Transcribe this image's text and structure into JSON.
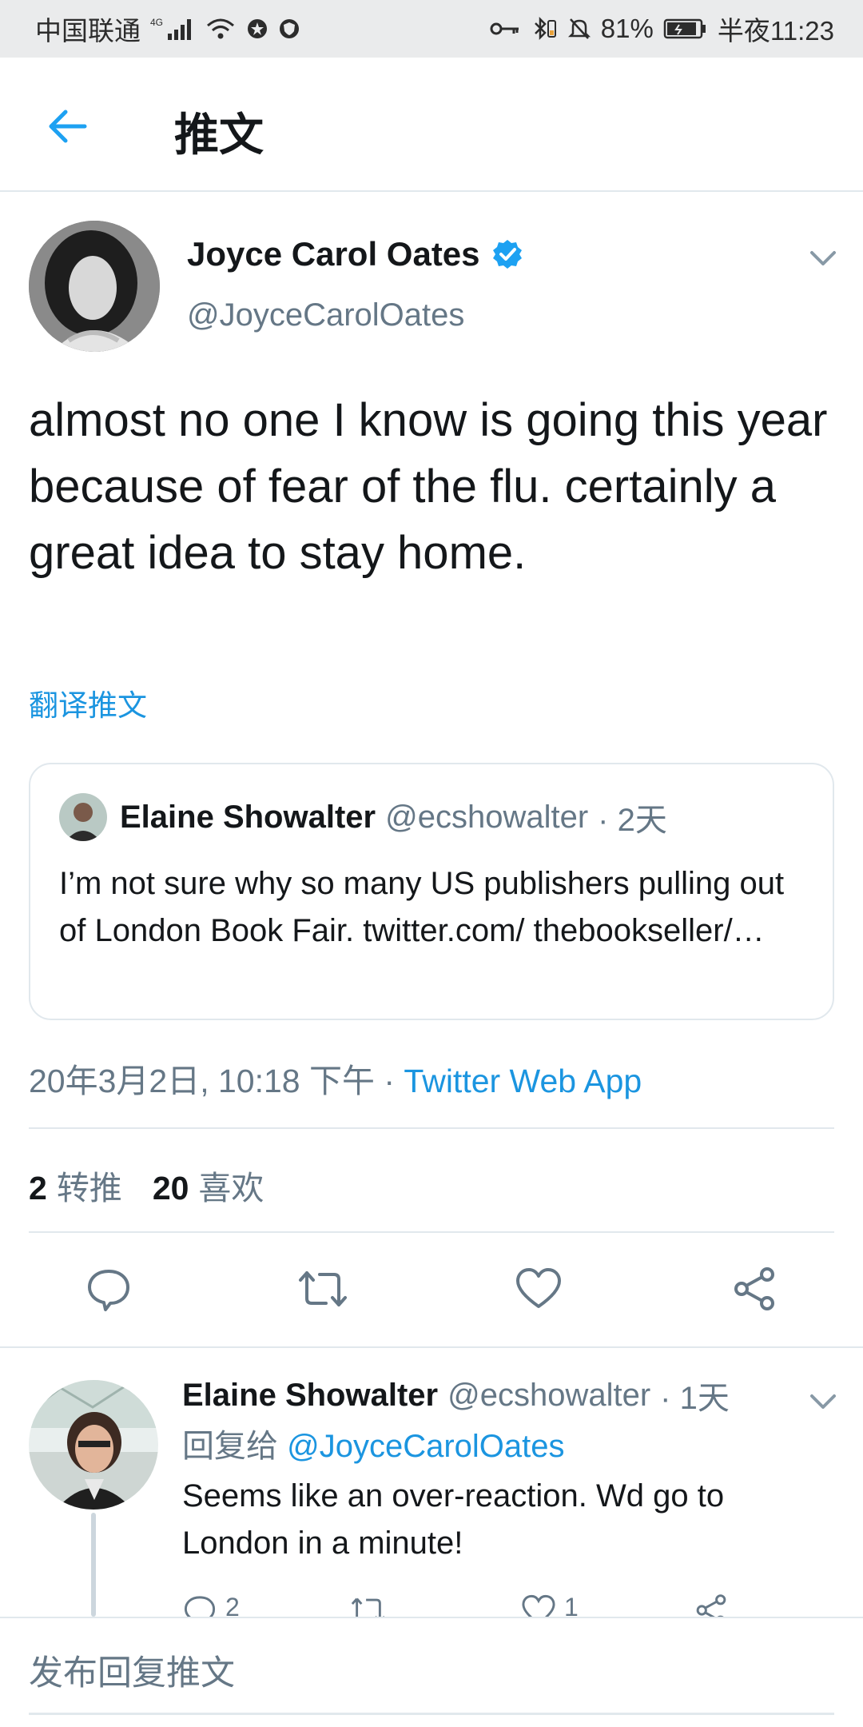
{
  "status_bar": {
    "carrier": "中国联通",
    "network": "4G",
    "battery": "81%",
    "time": "半夜11:23"
  },
  "app_bar": {
    "title": "推文"
  },
  "tweet": {
    "author_name": "Joyce Carol Oates",
    "author_handle": "@JoyceCarolOates",
    "text": "almost no one I know is going this year because of fear of the flu. certainly a great idea to stay home.",
    "translate_label": "翻译推文",
    "quote": {
      "name": "Elaine Showalter",
      "handle": "@ecshowalter",
      "age": "· 2天",
      "text": "I’m not sure why so many US publishers pulling out of London Book Fair. twitter.com/ thebookseller/…"
    },
    "timestamp": "20年3月2日, 10:18 下午 · ",
    "source": "Twitter Web App",
    "retweets_count": "2",
    "retweets_label": "转推",
    "likes_count": "20",
    "likes_label": "喜欢"
  },
  "reply": {
    "name": "Elaine Showalter",
    "handle": "@ecshowalter",
    "age": "· 1天",
    "reply_prefix": "回复给 ",
    "mention": "@JoyceCarolOates",
    "text": "Seems like an over-reaction. Wd go to London in a minute!",
    "reply_count": "2",
    "like_count": "1"
  },
  "compose": {
    "placeholder": "发布回复推文"
  },
  "icons": {
    "back": "arrow-left-icon",
    "verified": "verified-badge-icon",
    "chevron": "chevron-down-icon",
    "reply": "comment-icon",
    "retweet": "retweet-icon",
    "like": "heart-icon",
    "share": "share-icon"
  },
  "colors": {
    "accent": "#1da1f2",
    "link": "#1b95e0",
    "text_primary": "#14171a",
    "text_secondary": "#657786",
    "border": "#e1e8ed"
  }
}
